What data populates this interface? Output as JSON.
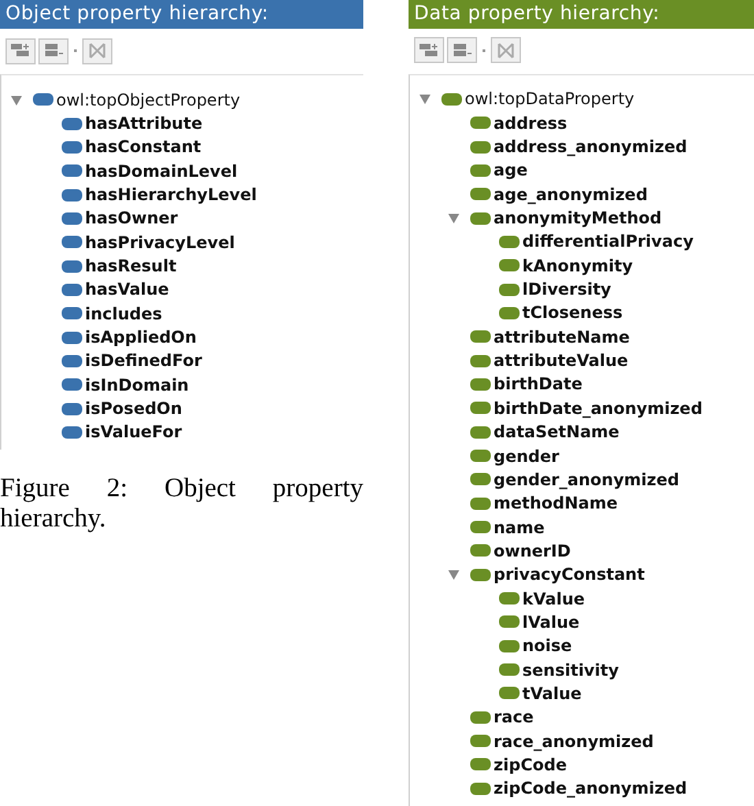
{
  "panels": [
    {
      "title": "Object property hierarchy:",
      "color": "#3a72ad",
      "tree": [
        {
          "label": "owl:topObjectProperty",
          "expanded": true,
          "children": [
            {
              "label": "hasAttribute"
            },
            {
              "label": "hasConstant"
            },
            {
              "label": "hasDomainLevel"
            },
            {
              "label": "hasHierarchyLevel"
            },
            {
              "label": "hasOwner"
            },
            {
              "label": "hasPrivacyLevel"
            },
            {
              "label": "hasResult"
            },
            {
              "label": "hasValue"
            },
            {
              "label": "includes"
            },
            {
              "label": "isAppliedOn"
            },
            {
              "label": "isDefinedFor"
            },
            {
              "label": "isInDomain"
            },
            {
              "label": "isPosedOn"
            },
            {
              "label": "isValueFor"
            }
          ]
        }
      ],
      "caption": "Figure 2: Object property hierarchy."
    },
    {
      "title": "Data property hierarchy:",
      "color": "#6a8f25",
      "tree": [
        {
          "label": "owl:topDataProperty",
          "expanded": true,
          "children": [
            {
              "label": "address"
            },
            {
              "label": "address_anonymized"
            },
            {
              "label": "age"
            },
            {
              "label": "age_anonymized"
            },
            {
              "label": "anonymityMethod",
              "expanded": true,
              "children": [
                {
                  "label": "differentialPrivacy"
                },
                {
                  "label": "kAnonymity"
                },
                {
                  "label": "lDiversity"
                },
                {
                  "label": "tCloseness"
                }
              ]
            },
            {
              "label": "attributeName"
            },
            {
              "label": "attributeValue"
            },
            {
              "label": "birthDate"
            },
            {
              "label": "birthDate_anonymized"
            },
            {
              "label": "dataSetName"
            },
            {
              "label": "gender"
            },
            {
              "label": "gender_anonymized"
            },
            {
              "label": "methodName"
            },
            {
              "label": "name"
            },
            {
              "label": "ownerID"
            },
            {
              "label": "privacyConstant",
              "expanded": true,
              "children": [
                {
                  "label": "kValue"
                },
                {
                  "label": "lValue"
                },
                {
                  "label": "noise"
                },
                {
                  "label": "sensitivity"
                },
                {
                  "label": "tValue"
                }
              ]
            },
            {
              "label": "race"
            },
            {
              "label": "race_anonymized"
            },
            {
              "label": "zipCode"
            },
            {
              "label": "zipCode_anonymized"
            }
          ]
        }
      ]
    }
  ]
}
